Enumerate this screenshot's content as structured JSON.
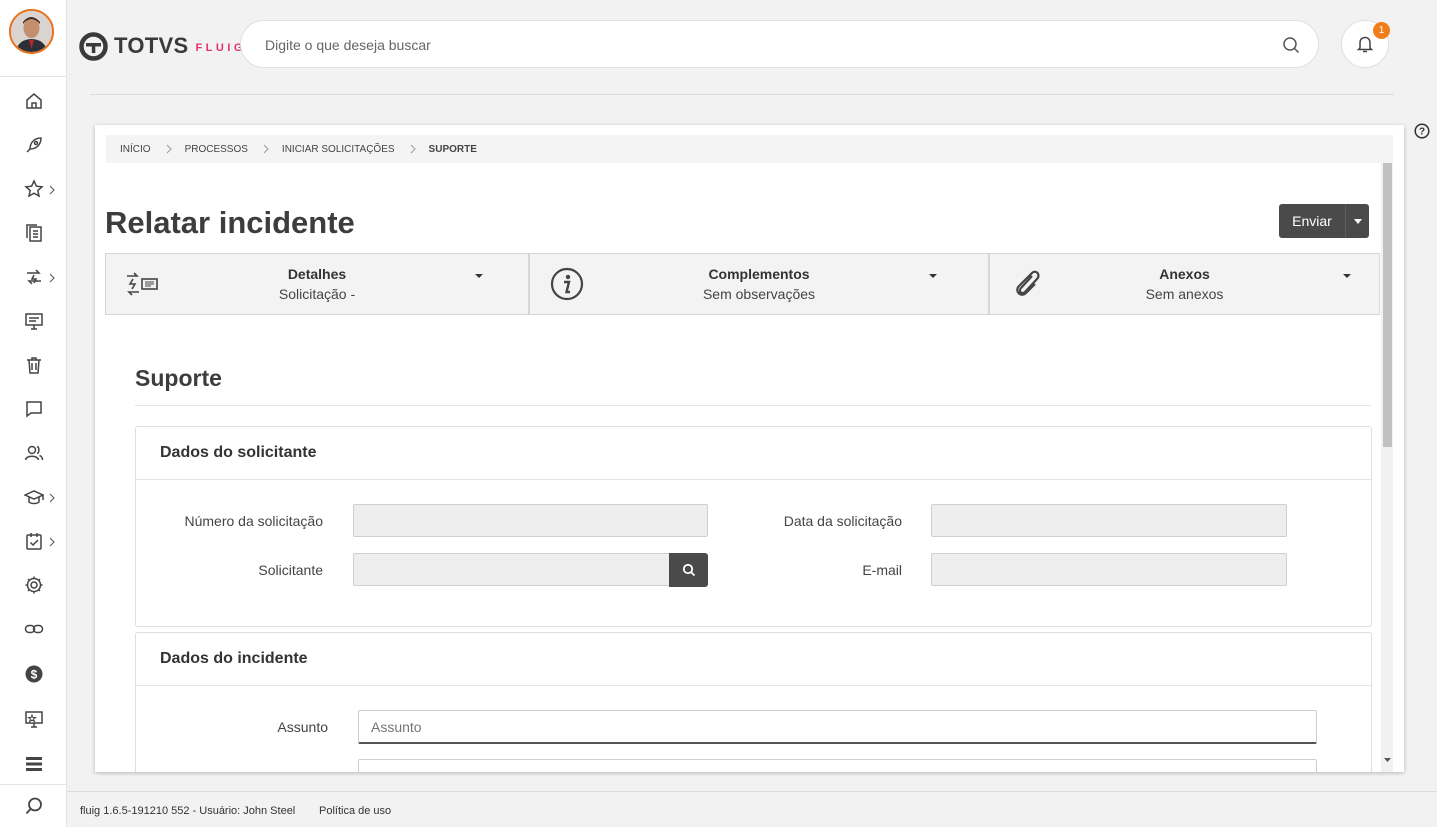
{
  "header": {
    "logo_brand": "TOTVS",
    "logo_product": "FLUIG",
    "search_placeholder": "Digite o que deseja buscar",
    "notification_count": "1"
  },
  "breadcrumb": [
    "INÍCIO",
    "PROCESSOS",
    "INICIAR SOLICITAÇÕES",
    "SUPORTE"
  ],
  "page": {
    "title": "Relatar incidente",
    "send_label": "Enviar"
  },
  "tabs": [
    {
      "title": "Detalhes",
      "subtitle": "Solicitação -",
      "icon": "process-flow-icon"
    },
    {
      "title": "Complementos",
      "subtitle": "Sem observações",
      "icon": "info-icon"
    },
    {
      "title": "Anexos",
      "subtitle": "Sem anexos",
      "icon": "paperclip-icon"
    }
  ],
  "form": {
    "title": "Suporte",
    "requester_section": {
      "heading": "Dados do solicitante",
      "request_number_label": "Número da solicitação",
      "request_date_label": "Data da solicitação",
      "requester_label": "Solicitante",
      "email_label": "E-mail"
    },
    "incident_section": {
      "heading": "Dados do incidente",
      "subject_label": "Assunto",
      "subject_placeholder": "Assunto"
    }
  },
  "sidebar_icons": [
    "home-icon",
    "rocket-icon",
    "star-icon",
    "documents-icon",
    "workflow-icon",
    "presentation-icon",
    "trash-icon",
    "chat-icon",
    "users-icon",
    "graduation-icon",
    "task-icon",
    "settings-icon",
    "link-icon",
    "dollar-icon",
    "monitor-icon",
    "list-icon",
    "search-icon"
  ],
  "footer": {
    "version": "fluig 1.6.5-191210 552 - Usuário: John Steel",
    "policy_link": "Política de uso"
  },
  "colors": {
    "accent_orange": "#f07d1a",
    "brand_pink": "#e5326e",
    "dark_button": "#4a4a4a"
  }
}
